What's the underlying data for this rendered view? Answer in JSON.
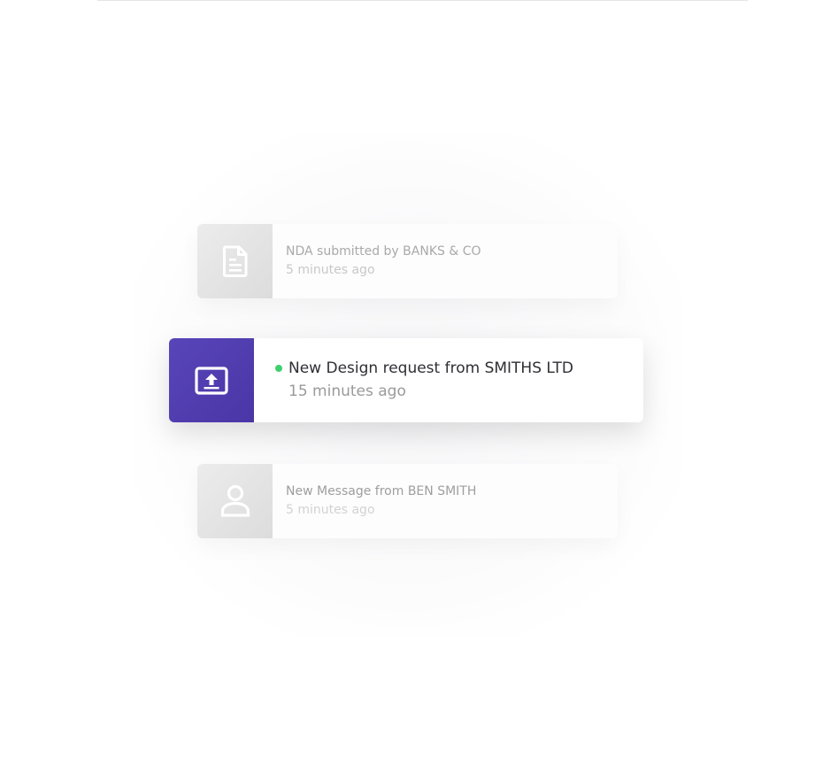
{
  "notifications": [
    {
      "icon": "document-icon",
      "title": "NDA submitted by BANKS & CO",
      "time": "5 minutes ago",
      "state": "dimmed"
    },
    {
      "icon": "upload-screen-icon",
      "title": "New Design request from SMITHS LTD",
      "time": "15 minutes ago",
      "state": "active",
      "unread": true
    },
    {
      "icon": "person-icon",
      "title": "New Message from BEN SMITH",
      "time": "5 minutes ago",
      "state": "dimmed"
    }
  ],
  "colors": {
    "accent": "#4f3db0",
    "unread_dot": "#3ecf6f",
    "muted_icon_bg": "#e4e4e4"
  }
}
